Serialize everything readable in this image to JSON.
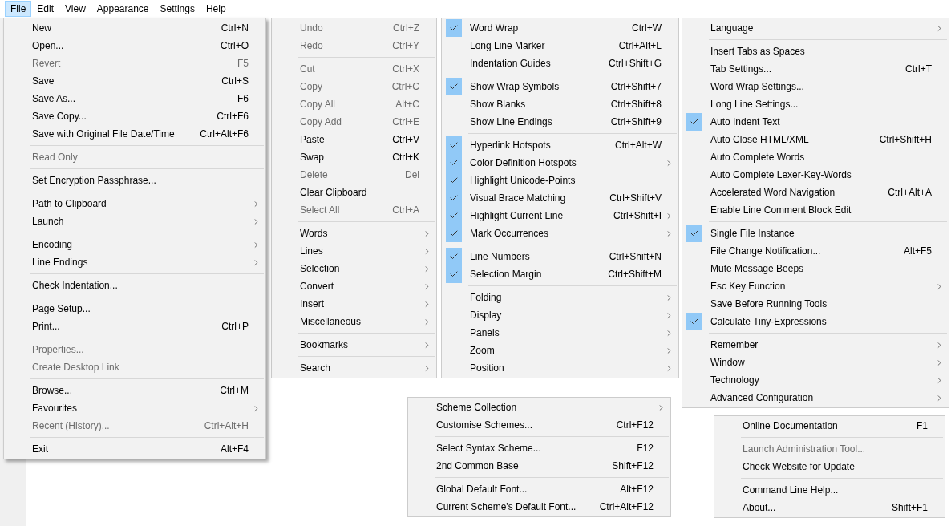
{
  "menubar": [
    {
      "label": "File",
      "selected": true
    },
    {
      "label": "Edit",
      "selected": false
    },
    {
      "label": "View",
      "selected": false
    },
    {
      "label": "Appearance",
      "selected": false
    },
    {
      "label": "Settings",
      "selected": false
    },
    {
      "label": "Help",
      "selected": false
    }
  ],
  "file_menu": {
    "items": [
      {
        "kind": "item",
        "label": "New",
        "shortcut": "Ctrl+N",
        "disabled": false,
        "submenu": false
      },
      {
        "kind": "item",
        "label": "Open...",
        "shortcut": "Ctrl+O",
        "disabled": false,
        "submenu": false
      },
      {
        "kind": "item",
        "label": "Revert",
        "shortcut": "F5",
        "disabled": true,
        "submenu": false
      },
      {
        "kind": "item",
        "label": "Save",
        "shortcut": "Ctrl+S",
        "disabled": false,
        "submenu": false
      },
      {
        "kind": "item",
        "label": "Save As...",
        "shortcut": "F6",
        "disabled": false,
        "submenu": false
      },
      {
        "kind": "item",
        "label": "Save Copy...",
        "shortcut": "Ctrl+F6",
        "disabled": false,
        "submenu": false
      },
      {
        "kind": "item",
        "label": "Save with Original File Date/Time",
        "shortcut": "Ctrl+Alt+F6",
        "disabled": false,
        "submenu": false
      },
      {
        "kind": "separator"
      },
      {
        "kind": "item",
        "label": "Read Only",
        "disabled": true,
        "submenu": false
      },
      {
        "kind": "separator"
      },
      {
        "kind": "item",
        "label": "Set Encryption Passphrase...",
        "disabled": false,
        "submenu": false
      },
      {
        "kind": "separator"
      },
      {
        "kind": "item",
        "label": "Path to Clipboard",
        "disabled": false,
        "submenu": true
      },
      {
        "kind": "item",
        "label": "Launch",
        "disabled": false,
        "submenu": true
      },
      {
        "kind": "separator"
      },
      {
        "kind": "item",
        "label": "Encoding",
        "disabled": false,
        "submenu": true
      },
      {
        "kind": "item",
        "label": "Line Endings",
        "disabled": false,
        "submenu": true
      },
      {
        "kind": "separator"
      },
      {
        "kind": "item",
        "label": "Check Indentation...",
        "disabled": false,
        "submenu": false
      },
      {
        "kind": "separator"
      },
      {
        "kind": "item",
        "label": "Page Setup...",
        "disabled": false,
        "submenu": false
      },
      {
        "kind": "item",
        "label": "Print...",
        "shortcut": "Ctrl+P",
        "disabled": false,
        "submenu": false
      },
      {
        "kind": "separator"
      },
      {
        "kind": "item",
        "label": "Properties...",
        "disabled": true,
        "submenu": false
      },
      {
        "kind": "item",
        "label": "Create Desktop Link",
        "disabled": true,
        "submenu": false
      },
      {
        "kind": "separator"
      },
      {
        "kind": "item",
        "label": "Browse...",
        "shortcut": "Ctrl+M",
        "disabled": false,
        "submenu": false
      },
      {
        "kind": "item",
        "label": "Favourites",
        "disabled": false,
        "submenu": true
      },
      {
        "kind": "item",
        "label": "Recent (History)...",
        "shortcut": "Ctrl+Alt+H",
        "disabled": true,
        "submenu": false
      },
      {
        "kind": "separator"
      },
      {
        "kind": "item",
        "label": "Exit",
        "shortcut": "Alt+F4",
        "disabled": false,
        "submenu": false
      }
    ]
  },
  "edit_menu": {
    "items": [
      {
        "kind": "item",
        "label": "Undo",
        "shortcut": "Ctrl+Z",
        "disabled": true,
        "submenu": false
      },
      {
        "kind": "item",
        "label": "Redo",
        "shortcut": "Ctrl+Y",
        "disabled": true,
        "submenu": false
      },
      {
        "kind": "separator"
      },
      {
        "kind": "item",
        "label": "Cut",
        "shortcut": "Ctrl+X",
        "disabled": true,
        "submenu": false
      },
      {
        "kind": "item",
        "label": "Copy",
        "shortcut": "Ctrl+C",
        "disabled": true,
        "submenu": false
      },
      {
        "kind": "item",
        "label": "Copy All",
        "shortcut": "Alt+C",
        "disabled": true,
        "submenu": false
      },
      {
        "kind": "item",
        "label": "Copy Add",
        "shortcut": "Ctrl+E",
        "disabled": true,
        "submenu": false
      },
      {
        "kind": "item",
        "label": "Paste",
        "shortcut": "Ctrl+V",
        "disabled": false,
        "submenu": false
      },
      {
        "kind": "item",
        "label": "Swap",
        "shortcut": "Ctrl+K",
        "disabled": false,
        "submenu": false
      },
      {
        "kind": "item",
        "label": "Delete",
        "shortcut": "Del",
        "disabled": true,
        "submenu": false
      },
      {
        "kind": "item",
        "label": "Clear Clipboard",
        "disabled": false,
        "submenu": false
      },
      {
        "kind": "item",
        "label": "Select All",
        "shortcut": "Ctrl+A",
        "disabled": true,
        "submenu": false
      },
      {
        "kind": "separator"
      },
      {
        "kind": "item",
        "label": "Words",
        "disabled": false,
        "submenu": true
      },
      {
        "kind": "item",
        "label": "Lines",
        "disabled": false,
        "submenu": true
      },
      {
        "kind": "item",
        "label": "Selection",
        "disabled": false,
        "submenu": true
      },
      {
        "kind": "item",
        "label": "Convert",
        "disabled": false,
        "submenu": true
      },
      {
        "kind": "item",
        "label": "Insert",
        "disabled": false,
        "submenu": true
      },
      {
        "kind": "item",
        "label": "Miscellaneous",
        "disabled": false,
        "submenu": true
      },
      {
        "kind": "separator"
      },
      {
        "kind": "item",
        "label": "Bookmarks",
        "disabled": false,
        "submenu": true
      },
      {
        "kind": "separator"
      },
      {
        "kind": "item",
        "label": "Search",
        "disabled": false,
        "submenu": true
      }
    ]
  },
  "view_menu": {
    "items": [
      {
        "kind": "item",
        "label": "Word Wrap",
        "shortcut": "Ctrl+W",
        "checked": true,
        "disabled": false,
        "submenu": false
      },
      {
        "kind": "item",
        "label": "Long Line Marker",
        "shortcut": "Ctrl+Alt+L",
        "checked": false,
        "disabled": false,
        "submenu": false
      },
      {
        "kind": "item",
        "label": "Indentation Guides",
        "shortcut": "Ctrl+Shift+G",
        "checked": false,
        "disabled": false,
        "submenu": false
      },
      {
        "kind": "separator"
      },
      {
        "kind": "item",
        "label": "Show Wrap Symbols",
        "shortcut": "Ctrl+Shift+7",
        "checked": true,
        "disabled": false,
        "submenu": false
      },
      {
        "kind": "item",
        "label": "Show Blanks",
        "shortcut": "Ctrl+Shift+8",
        "checked": false,
        "disabled": false,
        "submenu": false
      },
      {
        "kind": "item",
        "label": "Show Line Endings",
        "shortcut": "Ctrl+Shift+9",
        "checked": false,
        "disabled": false,
        "submenu": false
      },
      {
        "kind": "separator"
      },
      {
        "kind": "item",
        "label": "Hyperlink Hotspots",
        "shortcut": "Ctrl+Alt+W",
        "checked": true,
        "disabled": false,
        "submenu": false
      },
      {
        "kind": "item",
        "label": "Color Definition Hotspots",
        "checked": true,
        "disabled": false,
        "submenu": true
      },
      {
        "kind": "item",
        "label": "Highlight Unicode-Points",
        "checked": true,
        "disabled": false,
        "submenu": false
      },
      {
        "kind": "item",
        "label": "Visual Brace Matching",
        "shortcut": "Ctrl+Shift+V",
        "checked": true,
        "disabled": false,
        "submenu": false
      },
      {
        "kind": "item",
        "label": "Highlight Current Line",
        "shortcut": "Ctrl+Shift+I",
        "checked": true,
        "disabled": false,
        "submenu": true
      },
      {
        "kind": "item",
        "label": "Mark Occurrences",
        "checked": true,
        "disabled": false,
        "submenu": true
      },
      {
        "kind": "separator"
      },
      {
        "kind": "item",
        "label": "Line Numbers",
        "shortcut": "Ctrl+Shift+N",
        "checked": true,
        "disabled": false,
        "submenu": false
      },
      {
        "kind": "item",
        "label": "Selection Margin",
        "shortcut": "Ctrl+Shift+M",
        "checked": true,
        "disabled": false,
        "submenu": false
      },
      {
        "kind": "separator"
      },
      {
        "kind": "item",
        "label": "Folding",
        "checked": false,
        "disabled": false,
        "submenu": true
      },
      {
        "kind": "item",
        "label": "Display",
        "checked": false,
        "disabled": false,
        "submenu": true
      },
      {
        "kind": "item",
        "label": "Panels",
        "checked": false,
        "disabled": false,
        "submenu": true
      },
      {
        "kind": "item",
        "label": "Zoom",
        "checked": false,
        "disabled": false,
        "submenu": true
      },
      {
        "kind": "item",
        "label": "Position",
        "checked": false,
        "disabled": false,
        "submenu": true
      }
    ]
  },
  "settings_menu": {
    "items": [
      {
        "kind": "item",
        "label": "Language",
        "checked": false,
        "disabled": false,
        "submenu": true
      },
      {
        "kind": "separator"
      },
      {
        "kind": "item",
        "label": "Insert Tabs as Spaces",
        "checked": false,
        "disabled": false,
        "submenu": false
      },
      {
        "kind": "item",
        "label": "Tab Settings...",
        "shortcut": "Ctrl+T",
        "checked": false,
        "disabled": false,
        "submenu": false
      },
      {
        "kind": "item",
        "label": "Word Wrap Settings...",
        "checked": false,
        "disabled": false,
        "submenu": false
      },
      {
        "kind": "item",
        "label": "Long Line Settings...",
        "checked": false,
        "disabled": false,
        "submenu": false
      },
      {
        "kind": "item",
        "label": "Auto Indent Text",
        "checked": true,
        "disabled": false,
        "submenu": false
      },
      {
        "kind": "item",
        "label": "Auto Close HTML/XML",
        "shortcut": "Ctrl+Shift+H",
        "checked": false,
        "disabled": false,
        "submenu": false
      },
      {
        "kind": "item",
        "label": "Auto Complete Words",
        "checked": false,
        "disabled": false,
        "submenu": false
      },
      {
        "kind": "item",
        "label": "Auto Complete Lexer-Key-Words",
        "checked": false,
        "disabled": false,
        "submenu": false
      },
      {
        "kind": "item",
        "label": "Accelerated Word Navigation",
        "shortcut": "Ctrl+Alt+A",
        "checked": false,
        "disabled": false,
        "submenu": false
      },
      {
        "kind": "item",
        "label": "Enable Line Comment Block Edit",
        "checked": false,
        "disabled": false,
        "submenu": false
      },
      {
        "kind": "separator"
      },
      {
        "kind": "item",
        "label": "Single File Instance",
        "checked": true,
        "disabled": false,
        "submenu": false
      },
      {
        "kind": "item",
        "label": "File Change Notification...",
        "shortcut": "Alt+F5",
        "checked": false,
        "disabled": false,
        "submenu": false
      },
      {
        "kind": "item",
        "label": "Mute Message Beeps",
        "checked": false,
        "disabled": false,
        "submenu": false
      },
      {
        "kind": "item",
        "label": "Esc Key Function",
        "checked": false,
        "disabled": false,
        "submenu": true
      },
      {
        "kind": "item",
        "label": "Save Before Running Tools",
        "checked": false,
        "disabled": false,
        "submenu": false
      },
      {
        "kind": "item",
        "label": "Calculate Tiny-Expressions",
        "checked": true,
        "disabled": false,
        "submenu": false
      },
      {
        "kind": "separator"
      },
      {
        "kind": "item",
        "label": "Remember",
        "checked": false,
        "disabled": false,
        "submenu": true
      },
      {
        "kind": "item",
        "label": "Window",
        "checked": false,
        "disabled": false,
        "submenu": true
      },
      {
        "kind": "item",
        "label": "Technology",
        "checked": false,
        "disabled": false,
        "submenu": true
      },
      {
        "kind": "item",
        "label": "Advanced Configuration",
        "checked": false,
        "disabled": false,
        "submenu": true
      }
    ]
  },
  "appearance_menu": {
    "items": [
      {
        "kind": "item",
        "label": "Scheme Collection",
        "disabled": false,
        "submenu": true
      },
      {
        "kind": "item",
        "label": "Customise Schemes...",
        "shortcut": "Ctrl+F12",
        "disabled": false,
        "submenu": false
      },
      {
        "kind": "separator"
      },
      {
        "kind": "item",
        "label": "Select Syntax Scheme...",
        "shortcut": "F12",
        "disabled": false,
        "submenu": false
      },
      {
        "kind": "item",
        "label": "2nd Common Base",
        "shortcut": "Shift+F12",
        "disabled": false,
        "submenu": false
      },
      {
        "kind": "separator"
      },
      {
        "kind": "item",
        "label": "Global Default Font...",
        "shortcut": "Alt+F12",
        "disabled": false,
        "submenu": false
      },
      {
        "kind": "item",
        "label": "Current Scheme's Default Font...",
        "shortcut": "Ctrl+Alt+F12",
        "disabled": false,
        "submenu": false
      }
    ]
  },
  "help_menu": {
    "items": [
      {
        "kind": "item",
        "label": "Online Documentation",
        "shortcut": "F1",
        "disabled": false,
        "submenu": false
      },
      {
        "kind": "separator"
      },
      {
        "kind": "item",
        "label": "Launch Administration Tool...",
        "disabled": true,
        "submenu": false
      },
      {
        "kind": "item",
        "label": "Check Website for Update",
        "disabled": false,
        "submenu": false
      },
      {
        "kind": "separator"
      },
      {
        "kind": "item",
        "label": "Command Line Help...",
        "disabled": false,
        "submenu": false
      },
      {
        "kind": "item",
        "label": "About...",
        "shortcut": "Shift+F1",
        "disabled": false,
        "submenu": false
      }
    ]
  }
}
